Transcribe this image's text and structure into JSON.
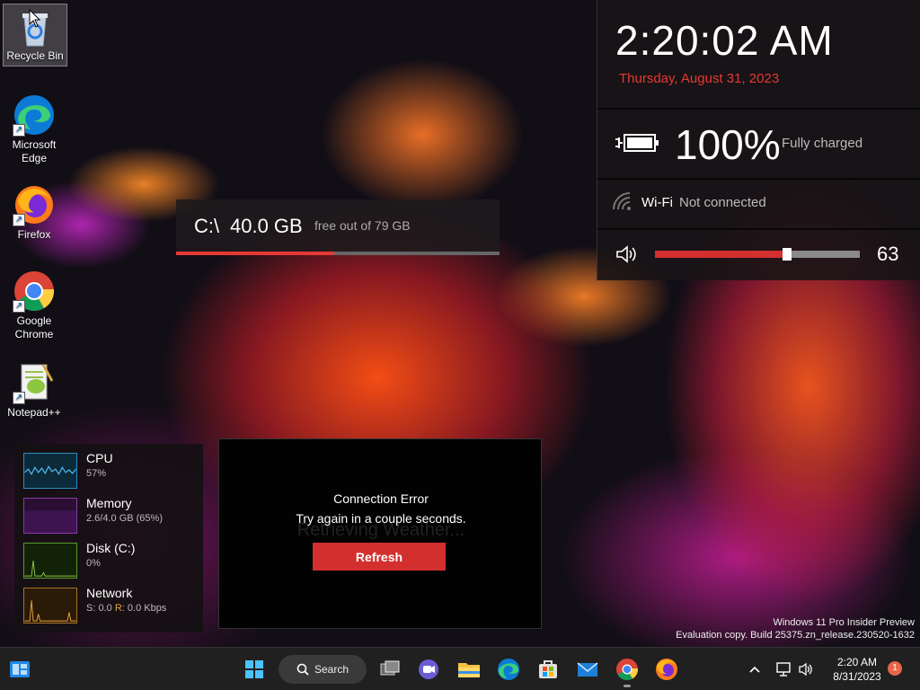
{
  "desktop": {
    "icons": [
      {
        "label": "Recycle Bin"
      },
      {
        "label": "Microsoft Edge"
      },
      {
        "label": "Firefox"
      },
      {
        "label": "Google Chrome"
      },
      {
        "label": "Notepad++"
      }
    ]
  },
  "status_panel": {
    "time": "2:20:02 AM",
    "date": "Thursday, August 31, 2023",
    "battery_percent": "100%",
    "battery_status": "Fully charged",
    "wifi_label": "Wi-Fi",
    "wifi_status": "Not connected",
    "volume_value": "63",
    "volume_level": 0.63
  },
  "disk_widget": {
    "drive": "C:\\",
    "free": "40.0 GB",
    "total_text": "free out of 79 GB",
    "used_fraction": 0.49
  },
  "perf_widget": {
    "cpu": {
      "name": "CPU",
      "value": "57%"
    },
    "memory": {
      "name": "Memory",
      "value": "2.6/4.0 GB (65%)"
    },
    "disk": {
      "name": "Disk (C:)",
      "value": "0%"
    },
    "network": {
      "name": "Network",
      "s_label": "S:",
      "s_value": "0.0",
      "r_label": "R:",
      "r_value": "0.0 Kbps"
    }
  },
  "weather_widget": {
    "background_text": "Retrieving Weather...",
    "title": "Connection Error",
    "message": "Try again in a couple seconds.",
    "refresh_label": "Refresh"
  },
  "watermark": {
    "line1": "Windows 11 Pro Insider Preview",
    "line2": "Evaluation copy. Build 25375.zn_release.230520-1632"
  },
  "taskbar": {
    "search_label": "Search",
    "time": "2:20 AM",
    "date": "8/31/2023",
    "notification_count": "1"
  },
  "colors": {
    "accent_red": "#d32f2f",
    "date_red": "#e53935"
  }
}
